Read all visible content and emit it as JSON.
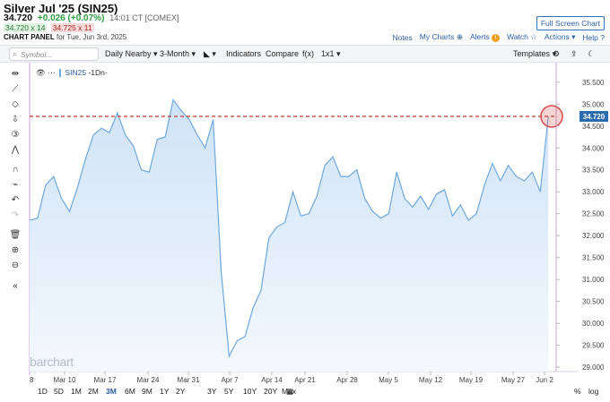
{
  "header": {
    "title": "Silver Jul '25 (SIN25)",
    "last": "34.720",
    "change": "+0.026 (+0.07%)",
    "time": "14:01 CT [COMEX]",
    "bid": "34.720 x 14",
    "ask": "34.725 x 11",
    "panel_label": "CHART PANEL",
    "panel_date": "for Tue, Jun 3rd, 2025",
    "fullscreen": "Full Screen Chart",
    "notes": "Notes",
    "mycharts": "My Charts",
    "alerts": "Alerts",
    "watch": "Watch",
    "actions": "Actions",
    "help": "Help"
  },
  "toolbar": {
    "symbol_placeholder": "Symbol...",
    "daily": "Daily Nearby",
    "period": "3-Month",
    "indicators": "Indicators",
    "compare": "Compare",
    "fx": "f(x)",
    "layout": "1x1",
    "templates": "Templates"
  },
  "legend": {
    "symbol": "SIN25",
    "interval": "-1Dn-"
  },
  "watermark": "barchart",
  "ranges": [
    "1D",
    "5D",
    "1M",
    "2M",
    "3M",
    "6M",
    "9M",
    "1Y",
    "2Y",
    "3Y",
    "5Y",
    "10Y",
    "20Y",
    "Max"
  ],
  "active_range": "3M",
  "range_right": [
    "%",
    "log"
  ],
  "colors": {
    "line": "#6fa8dc",
    "fill": "#cfe3f7",
    "price_line": "#c0392b",
    "price_tag": "#2b6cb0",
    "highlight": "#d9534f"
  },
  "chart_data": {
    "type": "area",
    "current_price_label": "34.720",
    "y_ticks": [
      "35.500",
      "35.000",
      "34.500",
      "34.000",
      "33.500",
      "33.000",
      "32.500",
      "32.000",
      "31.500",
      "31.000",
      "30.500",
      "30.000",
      "29.500",
      "29.000"
    ],
    "ylim": [
      28.9,
      35.7
    ],
    "x_ticks": [
      "Mar 10",
      "Mar 17",
      "Mar 24",
      "Mar 31",
      "Apr 7",
      "Apr 14",
      "Apr 21",
      "Apr 28",
      "May 5",
      "May 12",
      "May 19",
      "May 27",
      "Jun 2"
    ],
    "x_start_label": "8",
    "values": [
      32.35,
      32.4,
      33.15,
      33.35,
      32.85,
      32.55,
      33.1,
      33.75,
      34.3,
      34.45,
      34.35,
      34.8,
      34.3,
      34.05,
      33.5,
      33.45,
      34.2,
      34.25,
      35.1,
      34.85,
      34.65,
      34.3,
      34.0,
      34.65,
      31.2,
      29.25,
      29.6,
      29.7,
      30.35,
      30.75,
      31.95,
      32.2,
      32.3,
      33.0,
      32.45,
      32.5,
      32.9,
      33.6,
      33.8,
      33.35,
      33.35,
      33.5,
      32.85,
      32.55,
      32.4,
      32.5,
      33.45,
      32.85,
      32.65,
      32.9,
      32.6,
      32.95,
      33.05,
      32.45,
      32.7,
      32.35,
      32.5,
      33.15,
      33.65,
      33.25,
      33.6,
      33.35,
      33.25,
      33.45,
      33.0,
      34.72
    ]
  }
}
